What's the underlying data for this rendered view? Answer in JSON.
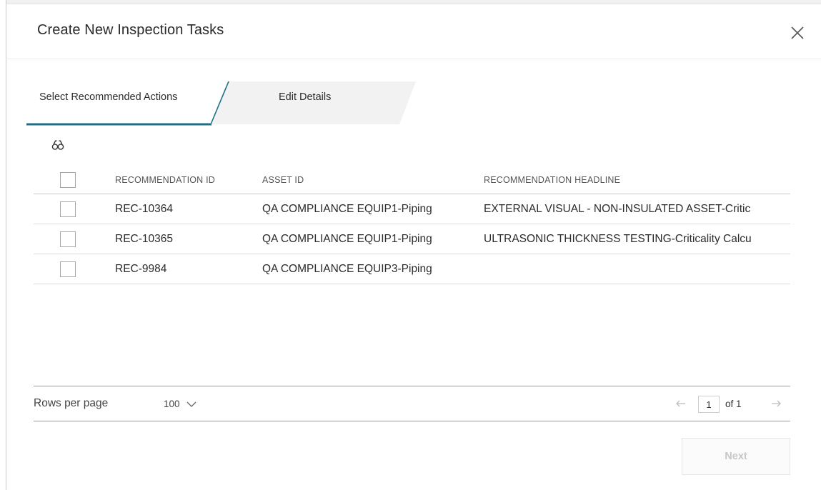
{
  "dialog": {
    "title": "Create New Inspection Tasks",
    "close_icon": "close-icon"
  },
  "steps": [
    {
      "label": "Select Recommended Actions",
      "active": true
    },
    {
      "label": "Edit Details",
      "active": false
    }
  ],
  "toolbar": {
    "search_icon": "binoculars-icon"
  },
  "table": {
    "columns": [
      "RECOMMENDATION ID",
      "ASSET ID",
      "RECOMMENDATION HEADLINE"
    ],
    "rows": [
      {
        "rec_id": "REC-10364",
        "asset_id": "QA COMPLIANCE EQUIP1-Piping",
        "headline": "EXTERNAL VISUAL - NON-INSULATED ASSET-Critic",
        "checked": false
      },
      {
        "rec_id": "REC-10365",
        "asset_id": "QA COMPLIANCE EQUIP1-Piping",
        "headline": "ULTRASONIC THICKNESS TESTING-Criticality Calcu",
        "checked": false
      },
      {
        "rec_id": "REC-9984",
        "asset_id": "QA COMPLIANCE EQUIP3-Piping",
        "headline": "",
        "checked": false
      }
    ]
  },
  "pagination": {
    "rows_per_page_label": "Rows per page",
    "rows_per_page_value": "100",
    "current_page": "1",
    "of_label": "of 1"
  },
  "actions": {
    "next_label": "Next"
  },
  "colors": {
    "accent": "#1f6f86",
    "inactive_tab": "#f2f2f2",
    "disabled_text": "#c7c7c7"
  }
}
